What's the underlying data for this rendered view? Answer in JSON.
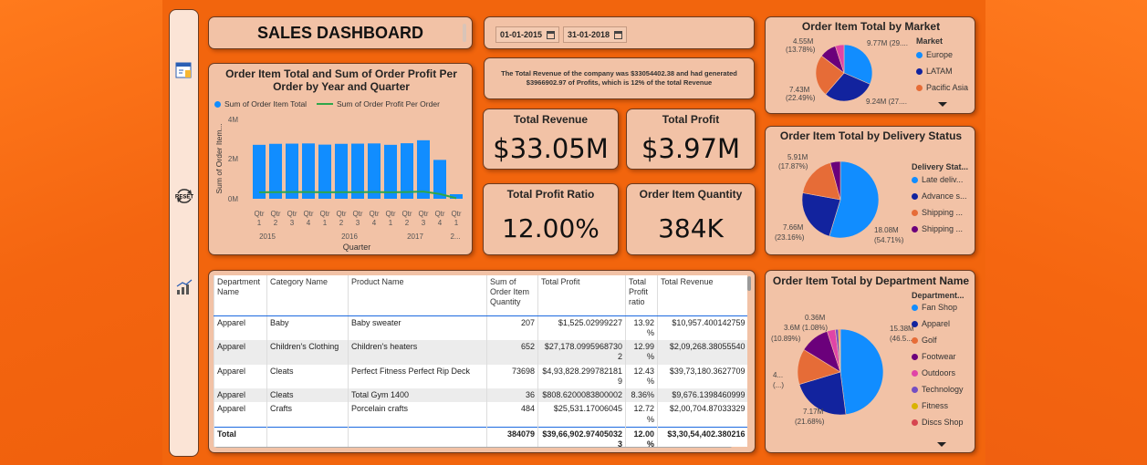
{
  "title": "SALES DASHBOARD",
  "sidebar": {
    "icons": [
      {
        "name": "report-icon"
      },
      {
        "name": "reset-icon",
        "label": "RESET"
      },
      {
        "name": "chart-icon"
      }
    ]
  },
  "dates": {
    "start": "01-01-2015",
    "end": "31-01-2018"
  },
  "summary": "The Total Revenue of the company was $33054402.38 and had generated $3966902.97 of Profits, which is 12% of the total Revenue",
  "kpis": {
    "revenue": {
      "label": "Total Revenue",
      "value": "$33.05M"
    },
    "profit": {
      "label": "Total Profit",
      "value": "$3.97M"
    },
    "ratio": {
      "label": "Total Profit Ratio",
      "value": "12.00%"
    },
    "qty": {
      "label": "Order Item Quantity",
      "value": "384K"
    }
  },
  "combo": {
    "title": "Order Item Total and Sum of Order Profit Per Order by Year and Quarter",
    "legend": [
      "Sum of Order Item Total",
      "Sum of Order Profit Per Order"
    ],
    "ylabel": "Sum of Order Item...",
    "xlabel": "Quarter",
    "yticks": [
      "4M",
      "2M",
      "0M"
    ],
    "years": [
      "2015",
      "2016",
      "2017",
      "2..."
    ],
    "colors": {
      "bar": "#118dff",
      "line": "#2ea64a"
    }
  },
  "chart_data": [
    {
      "type": "bar",
      "title": "Order Item Total and Sum of Order Profit Per Order by Year and Quarter",
      "xlabel": "Quarter",
      "ylabel": "Sum of Order Item...",
      "ylim": [
        0,
        4000000
      ],
      "categories": [
        "Qtr 1",
        "Qtr 2",
        "Qtr 3",
        "Qtr 4",
        "Qtr 1",
        "Qtr 2",
        "Qtr 3",
        "Qtr 4",
        "Qtr 1",
        "Qtr 2",
        "Qtr 3",
        "Qtr 4",
        "Qtr 1"
      ],
      "series": [
        {
          "name": "Sum of Order Item Total",
          "values": [
            2720000,
            2770000,
            2780000,
            2790000,
            2730000,
            2770000,
            2780000,
            2790000,
            2720000,
            2800000,
            2950000,
            1960000,
            230000
          ]
        },
        {
          "name": "Sum of Order Profit Per Order",
          "values": [
            330000,
            335000,
            337000,
            338000,
            330000,
            334000,
            336000,
            338000,
            329000,
            340000,
            360000,
            240000,
            30000
          ]
        }
      ]
    },
    {
      "type": "pie",
      "title": "Order Item Total by Market",
      "legend_title": "Market",
      "labels": [
        "Europe",
        "LATAM",
        "Pacific Asia",
        "Other"
      ],
      "values": [
        9.77,
        9.24,
        7.43,
        4.55
      ],
      "colors": [
        "#118dff",
        "#12239e",
        "#e66c37",
        "#6b007b",
        "#e044a7"
      ],
      "data_labels": [
        "9.77M (29....",
        "9.24M (27....",
        "7.43M (22.49%)",
        "4.55M (13.78%)"
      ]
    },
    {
      "type": "pie",
      "title": "Order Item Total by Delivery Status",
      "legend_title": "Delivery Stat...",
      "labels": [
        "Late deliv...",
        "Advance s...",
        "Shipping ...",
        "Shipping ..."
      ],
      "values": [
        18.08,
        7.66,
        5.91,
        1.41
      ],
      "colors": [
        "#118dff",
        "#12239e",
        "#e66c37",
        "#6b007b"
      ],
      "data_labels": [
        "18.08M (54.71%)",
        "7.66M (23.16%)",
        "5.91M (17.87%)"
      ]
    },
    {
      "type": "pie",
      "title": "Order Item Total by Department Name",
      "legend_title": "Department...",
      "labels": [
        "Fan Shop",
        "Apparel",
        "Golf",
        "Footwear",
        "Outdoors",
        "Technology",
        "Fitness",
        "Discs Shop"
      ],
      "values": [
        15.38,
        7.17,
        4.3,
        3.6,
        1.0,
        0.36,
        0.15,
        0.1
      ],
      "colors": [
        "#118dff",
        "#12239e",
        "#e66c37",
        "#6b007b",
        "#e044a7",
        "#744ec2",
        "#d9b300",
        "#d64550"
      ],
      "data_labels": [
        "15.38M (46.5...",
        "7.17M (21.68%)",
        "4.... (...)",
        "3.6M (10.89%)",
        "3.6M (1.08%)",
        "0.36M"
      ]
    }
  ],
  "market": {
    "title": "Order Item Total by Market",
    "legend_title": "Market",
    "legend": [
      "Europe",
      "LATAM",
      "Pacific Asia"
    ],
    "labels": {
      "a": "4.55M",
      "a2": "(13.78%)",
      "b": "9.77M (29....",
      "c": "7.43M",
      "c2": "(22.49%)",
      "d": "9.24M (27...."
    }
  },
  "delivery": {
    "title": "Order Item Total by Delivery Status",
    "legend_title": "Delivery Stat...",
    "legend": [
      "Late deliv...",
      "Advance s...",
      "Shipping ...",
      "Shipping ..."
    ],
    "labels": {
      "a": "5.91M",
      "a2": "(17.87%)",
      "b": "7.66M",
      "b2": "(23.16%)",
      "c": "18.08M",
      "c2": "(54.71%)"
    }
  },
  "dept": {
    "title": "Order Item Total by Department Name",
    "legend_title": "Department...",
    "legend": [
      "Fan Shop",
      "Apparel",
      "Golf",
      "Footwear",
      "Outdoors",
      "Technology",
      "Fitness",
      "Discs Shop"
    ],
    "labels": {
      "a": "0.36M",
      "b": "3.6M (1.08%)",
      "c": "(10.89%)",
      "d": "15.38M",
      "d2": "(46.5...",
      "e": "4...",
      "e2": "(...)",
      "f": "7.17M",
      "f2": "(21.68%)"
    }
  },
  "table": {
    "headers": [
      "Department Name",
      "Category Name",
      "Product Name",
      "Sum of Order Item Quantity",
      "Total Profit",
      "Total Profit ratio",
      "Total Revenue"
    ],
    "rows": [
      [
        "Apparel",
        "Baby",
        "Baby sweater",
        "207",
        "$1,525.02999227",
        "13.92 %",
        "$10,957.400142759"
      ],
      [
        "Apparel",
        "Children's Clothing",
        "Children's heaters",
        "652",
        "$27,178.09959687302",
        "12.99 %",
        "$2,09,268.38055540"
      ],
      [
        "Apparel",
        "Cleats",
        "Perfect Fitness Perfect Rip Deck",
        "73698",
        "$4,93,828.2997821819",
        "12.43 %",
        "$39,73,180.3627709"
      ],
      [
        "Apparel",
        "Cleats",
        "Total Gym 1400",
        "36",
        "$808.6200083800002",
        "8.36%",
        "$9,676.1398460999"
      ],
      [
        "Apparel",
        "Crafts",
        "Porcelain crafts",
        "484",
        "$25,531.17006045",
        "12.72 %",
        "$2,00,704.87033329"
      ]
    ],
    "total": [
      "Total",
      "",
      "",
      "384079",
      "$39,66,902.974050323",
      "12.00 %",
      "$3,30,54,402.380216"
    ]
  }
}
